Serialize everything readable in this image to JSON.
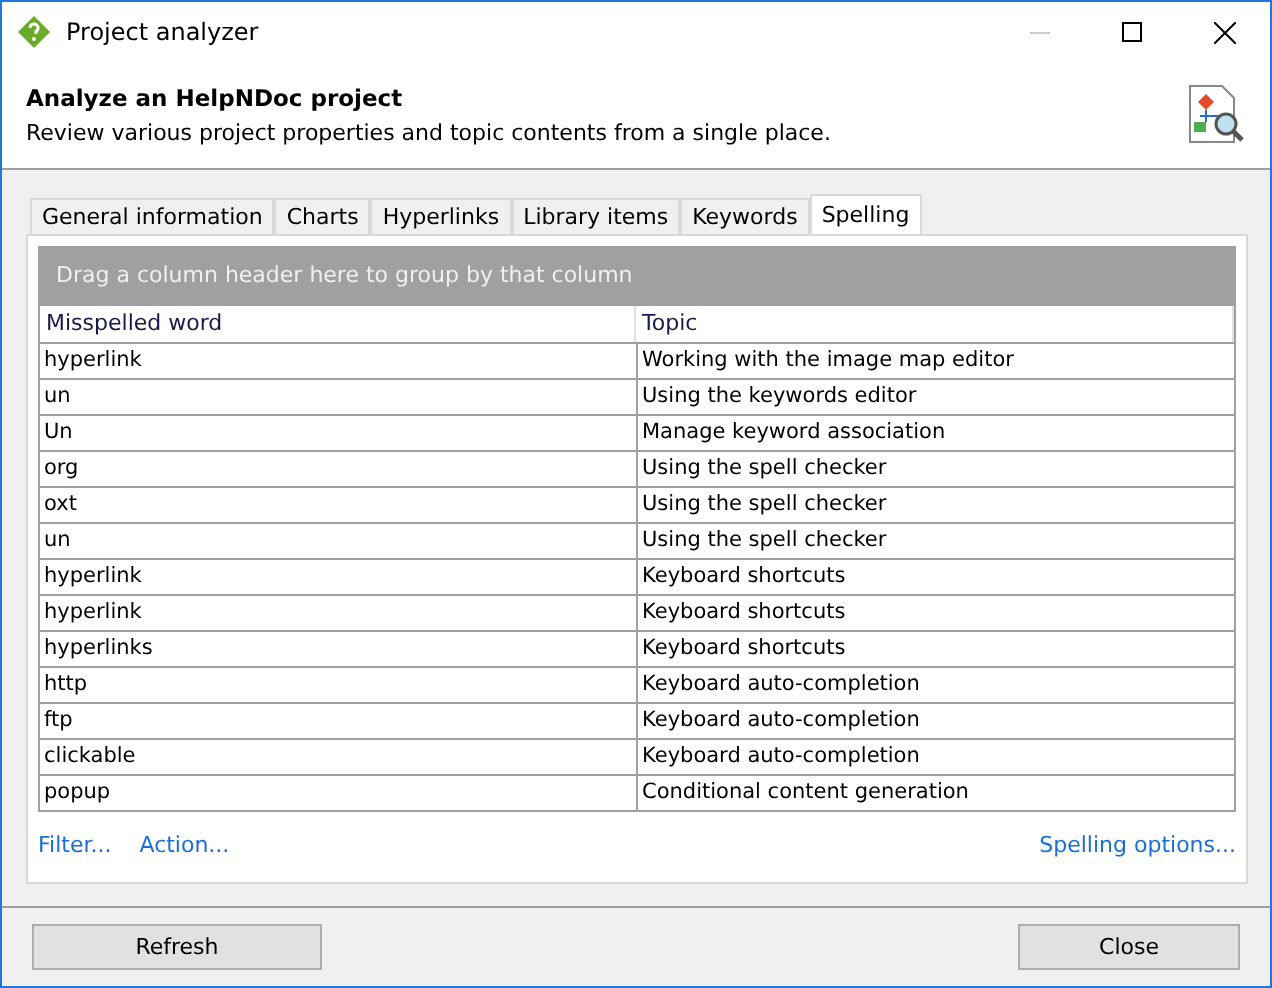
{
  "window": {
    "title": "Project analyzer"
  },
  "header": {
    "title": "Analyze an HelpNDoc project",
    "subtitle": "Review various project properties and topic contents from a single place."
  },
  "tabs": [
    {
      "label": "General information",
      "selected": false
    },
    {
      "label": "Charts",
      "selected": false
    },
    {
      "label": "Hyperlinks",
      "selected": false
    },
    {
      "label": "Library items",
      "selected": false
    },
    {
      "label": "Keywords",
      "selected": false
    },
    {
      "label": "Spelling",
      "selected": true
    }
  ],
  "grid": {
    "group_hint": "Drag a column header here to group by that column",
    "columns": [
      "Misspelled word",
      "Topic"
    ],
    "rows": [
      [
        "hyperlink",
        "Working with the image map editor"
      ],
      [
        "un",
        "Using the keywords editor"
      ],
      [
        "Un",
        "Manage keyword association"
      ],
      [
        "org",
        "Using the spell checker"
      ],
      [
        "oxt",
        "Using the spell checker"
      ],
      [
        "un",
        "Using the spell checker"
      ],
      [
        "hyperlink",
        "Keyboard shortcuts"
      ],
      [
        "hyperlink",
        "Keyboard shortcuts"
      ],
      [
        "hyperlinks",
        "Keyboard shortcuts"
      ],
      [
        "http",
        "Keyboard auto-completion"
      ],
      [
        "ftp",
        "Keyboard auto-completion"
      ],
      [
        "clickable",
        "Keyboard auto-completion"
      ],
      [
        "popup",
        "Conditional content generation"
      ]
    ]
  },
  "links": {
    "left": [
      "Filter...",
      "Action..."
    ],
    "right": "Spelling options..."
  },
  "buttons": {
    "refresh": "Refresh",
    "close": "Close"
  }
}
